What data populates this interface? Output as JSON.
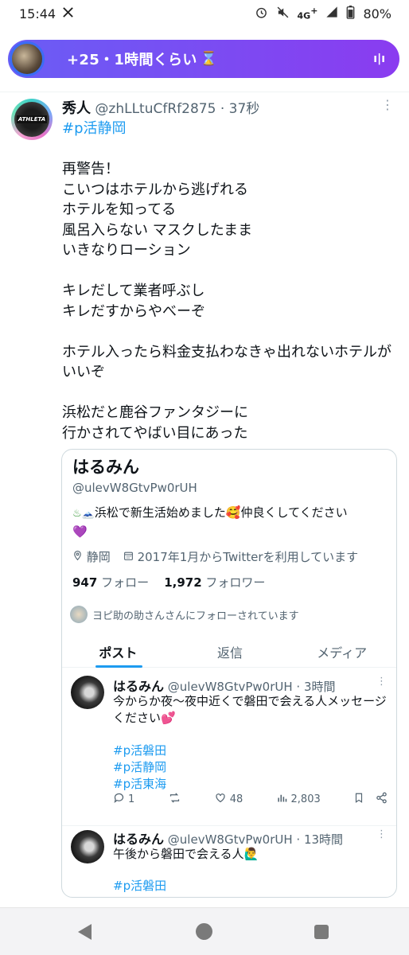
{
  "status_bar": {
    "time": "15:44",
    "app_icon": "x-logo-icon",
    "network": "4G",
    "network_sup": "+",
    "battery": "80%"
  },
  "live_banner": {
    "text": "+25・1時間くらい",
    "hourglass": "⌛",
    "bars": "ı|ı"
  },
  "tweet": {
    "name": "秀人",
    "handle": "@zhLLtuCfRf2875",
    "dot": "·",
    "time": "37秒",
    "hashtag": "#p活静岡",
    "paragraphs": [
      "再警告！\nこいつはホテルから逃げれる\nホテルを知ってる\n風呂入らない マスクしたまま\nいきなりローション",
      "キレだして業者呼ぶし\nキレだすからやべーぞ",
      "ホテル入ったら料金支払わなきゃ出れないホテルがいいぞ",
      "浜松だと鹿谷ファンタジーに\n行かされてやばい目にあった"
    ]
  },
  "profile_card": {
    "name": "はるみん",
    "handle": "@ulevW8GtvPw0rUH",
    "bio_icons": "♨🗻",
    "bio": "浜松で新生活始めました🥰仲良くしてください",
    "bio_end": "💜",
    "location": "静岡",
    "joined": "2017年1月からTwitterを利用しています",
    "following_count": "947",
    "following_label": "フォロー",
    "followers_count": "1,972",
    "followers_label": "フォロワー",
    "followed_by": "ヨピ助の助さんさんにフォローされています",
    "tabs": [
      "ポスト",
      "返信",
      "メディア"
    ]
  },
  "posts": [
    {
      "name": "はるみん",
      "handle": "@ulevW8GtvPw0rUH",
      "time": "· 3時間",
      "text": "今からか夜〜夜中近くで磐田で会える人メッセージください💕",
      "tags": [
        "#p活磐田",
        "#p活静岡",
        "#p活東海"
      ],
      "replies": "1",
      "likes": "48",
      "views": "2,803"
    },
    {
      "name": "はるみん",
      "handle": "@ulevW8GtvPw0rUH",
      "time": "· 13時間",
      "text": "午後から磐田で会える人🙋‍♂️",
      "tags": [
        "#p活磐田"
      ]
    }
  ]
}
